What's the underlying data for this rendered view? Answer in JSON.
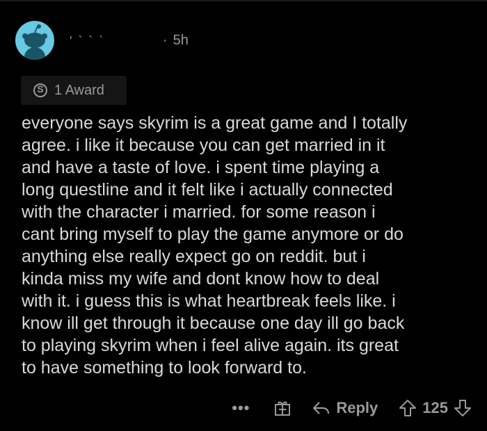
{
  "post": {
    "username": "' ` ` `",
    "separator": "·",
    "time": "5h",
    "award": {
      "icon": "silver-award-icon",
      "icon_glyph": "S",
      "label": "1 Award"
    },
    "comment_lines": [
      "everyone says skyrim is a great game and I totally",
      "agree. i like it because you can get married in it",
      "and have a taste of love. i spent time playing a",
      "long questline and it felt like i actually connected",
      "with the character i married. for some reason i",
      "cant bring myself to play the game anymore or do",
      "anything else really expect go on reddit. but i",
      "kinda miss my wife and dont know how to deal",
      "with it. i guess this is what heartbreak feels like. i",
      "know ill get through it because one day ill go back",
      "to playing skyrim when i feel alive again. its great",
      "to have something  to look forward to."
    ]
  },
  "actions": {
    "more": "•••",
    "reply_label": "Reply",
    "score": "125"
  },
  "colors": {
    "background": "#000000",
    "text": "#d7dadc",
    "muted": "#9a9a9a",
    "avatar": "#67c9e3"
  }
}
